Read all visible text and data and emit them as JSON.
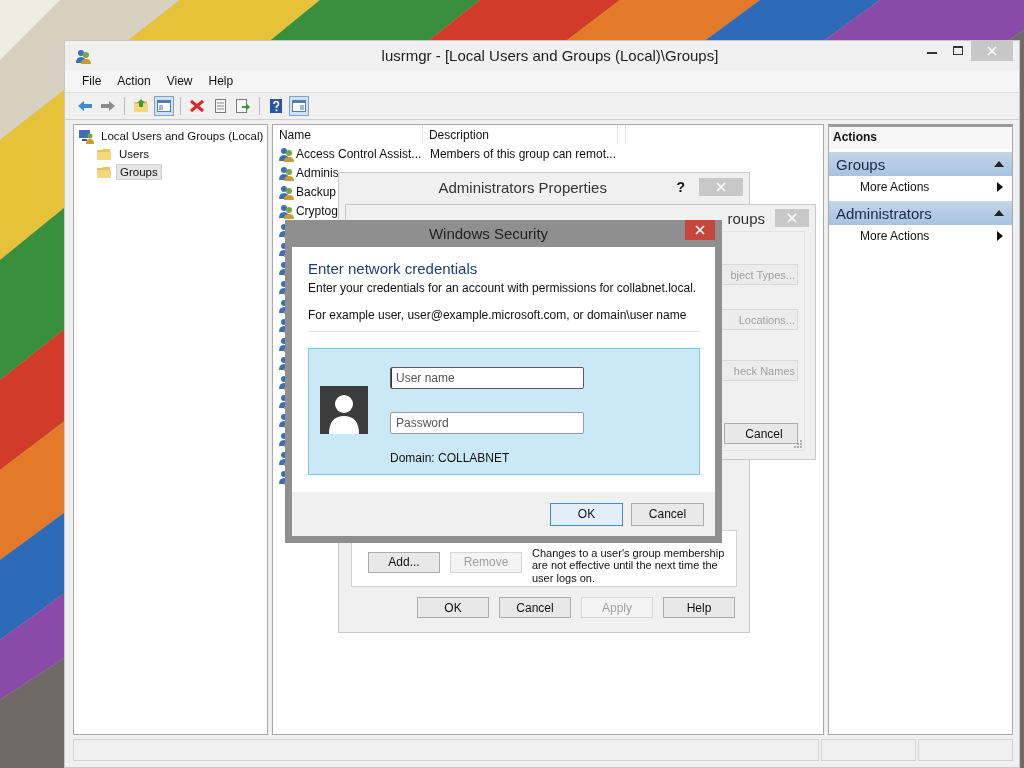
{
  "window": {
    "title": "lusrmgr - [Local Users and Groups (Local)\\Groups]"
  },
  "menu": [
    "File",
    "Action",
    "View",
    "Help"
  ],
  "toolbar": [
    {
      "kind": "back",
      "pressed": false
    },
    {
      "kind": "forward",
      "pressed": false
    },
    {
      "kind": "separator"
    },
    {
      "kind": "up",
      "pressed": false
    },
    {
      "kind": "tree",
      "pressed": true
    },
    {
      "kind": "separator"
    },
    {
      "kind": "delete",
      "pressed": false
    },
    {
      "kind": "properties",
      "pressed": false
    },
    {
      "kind": "export",
      "pressed": false
    },
    {
      "kind": "separator"
    },
    {
      "kind": "help",
      "pressed": false
    },
    {
      "kind": "pane",
      "pressed": true
    }
  ],
  "tree": [
    {
      "label": "Local Users and Groups (Local)",
      "selected": false,
      "children": [
        {
          "label": "Users",
          "selected": false
        },
        {
          "label": "Groups",
          "selected": true
        }
      ]
    }
  ],
  "list": {
    "columns": [
      "Name",
      "Description"
    ],
    "rows": [
      {
        "kind": "text",
        "name": "Access Control Assist...",
        "description": "Members of this group can remot..."
      },
      {
        "kind": "text",
        "name": "Adminis"
      },
      {
        "kind": "text",
        "name": "Backup"
      },
      {
        "kind": "text",
        "name": "Cryptog"
      },
      {
        "kind": "icon"
      },
      {
        "kind": "icon"
      },
      {
        "kind": "icon"
      },
      {
        "kind": "icon"
      },
      {
        "kind": "icon"
      },
      {
        "kind": "icon"
      },
      {
        "kind": "icon"
      },
      {
        "kind": "icon"
      },
      {
        "kind": "icon"
      },
      {
        "kind": "icon"
      },
      {
        "kind": "icon"
      },
      {
        "kind": "icon"
      },
      {
        "kind": "icon"
      },
      {
        "kind": "icon"
      }
    ]
  },
  "actions": {
    "title": "Actions",
    "sections": [
      {
        "title": "Groups",
        "expanded": true,
        "items": [
          "More Actions"
        ]
      },
      {
        "title": "Administrators",
        "expanded": true,
        "items": [
          "More Actions"
        ]
      }
    ]
  },
  "properties_dialog": {
    "title": "Administrators Properties",
    "help": "?",
    "member_buttons": [
      {
        "label": "Add...",
        "disabled": false
      },
      {
        "label": "Remove",
        "disabled": true
      }
    ],
    "note": "Changes to a user's group membership are not effective until the next time the user logs on.",
    "buttons": [
      {
        "label": "OK",
        "disabled": false
      },
      {
        "label": "Cancel",
        "disabled": false
      },
      {
        "label": "Apply",
        "disabled": true
      },
      {
        "label": "Help",
        "disabled": false
      }
    ]
  },
  "select_dialog": {
    "title": "roups",
    "buttons": [
      {
        "label": "bject Types...",
        "disabled": true
      },
      {
        "label": "Locations...",
        "disabled": true
      },
      {
        "label": "heck Names",
        "disabled": true
      },
      {
        "label": "Cancel",
        "disabled": false
      }
    ]
  },
  "security_dialog": {
    "title": "Windows Security",
    "heading": "Enter network credentials",
    "message": "Enter your credentials for an account with permissions for collabnet.local.",
    "example": "For example user, user@example.microsoft.com, or domain\\user name",
    "fields": [
      {
        "placeholder": "User name",
        "focused": true
      },
      {
        "placeholder": "Password",
        "focused": false
      }
    ],
    "domain": "Domain: COLLABNET",
    "buttons": [
      {
        "label": "OK",
        "default": true
      },
      {
        "label": "Cancel",
        "default": false
      }
    ]
  }
}
